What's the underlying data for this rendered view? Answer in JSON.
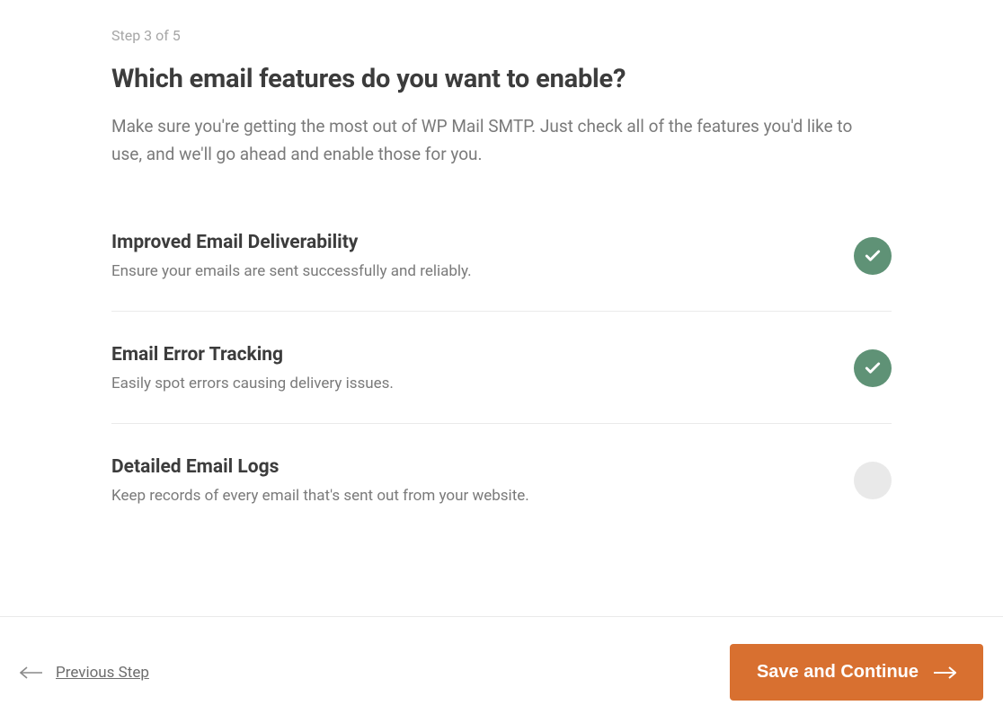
{
  "step_label": "Step 3 of 5",
  "heading": "Which email features do you want to enable?",
  "subtext": "Make sure you're getting the most out of WP Mail SMTP. Just check all of the features you'd like to use, and we'll go ahead and enable those for you.",
  "features": [
    {
      "title": "Improved Email Deliverability",
      "desc": "Ensure your emails are sent successfully and reliably.",
      "checked": true
    },
    {
      "title": "Email Error Tracking",
      "desc": "Easily spot errors causing delivery issues.",
      "checked": true
    },
    {
      "title": "Detailed Email Logs",
      "desc": "Keep records of every email that's sent out from your website.",
      "checked": false
    }
  ],
  "footer": {
    "prev_label": "Previous Step",
    "continue_label": "Save and Continue"
  },
  "colors": {
    "accent": "#d87030",
    "check_green": "#5f9276",
    "unchecked_gray": "#e9e9e9"
  }
}
